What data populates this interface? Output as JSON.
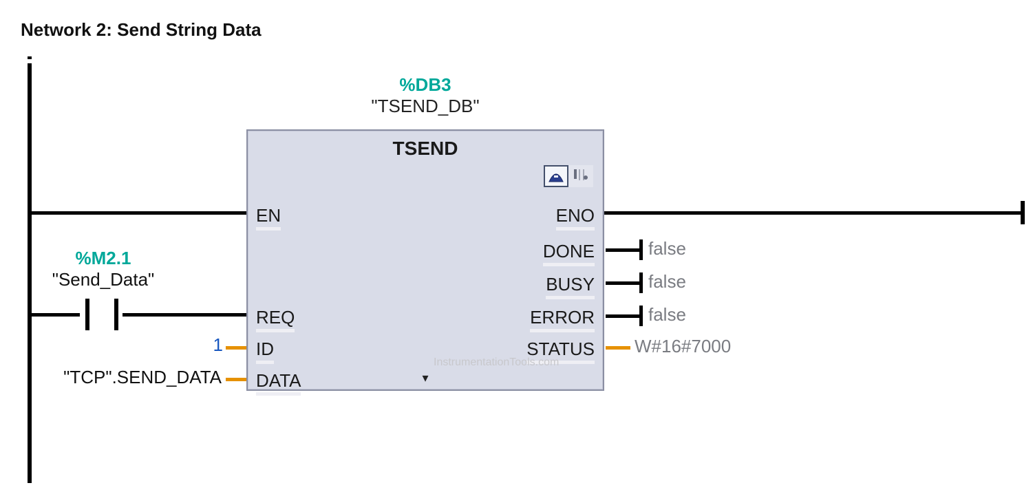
{
  "network": {
    "title": "Network 2: Send String Data"
  },
  "block": {
    "address": "%DB3",
    "symbol": "\"TSEND_DB\"",
    "name": "TSEND",
    "icons": {
      "diag": "diagnostics-icon",
      "tune": "parameters-icon"
    }
  },
  "inputs": {
    "en": "EN",
    "req": "REQ",
    "id": "ID",
    "data": "DATA"
  },
  "outputs": {
    "eno": "ENO",
    "done": "DONE",
    "busy": "BUSY",
    "error": "ERROR",
    "status": "STATUS"
  },
  "wiring": {
    "req_addr": "%M2.1",
    "req_symbol": "\"Send_Data\"",
    "id_value": "1",
    "data_value": "\"TCP\".SEND_DATA"
  },
  "out_values": {
    "done": "false",
    "busy": "false",
    "error": "false",
    "status": "W#16#7000"
  },
  "watermark": "InstrumentationTools.com"
}
